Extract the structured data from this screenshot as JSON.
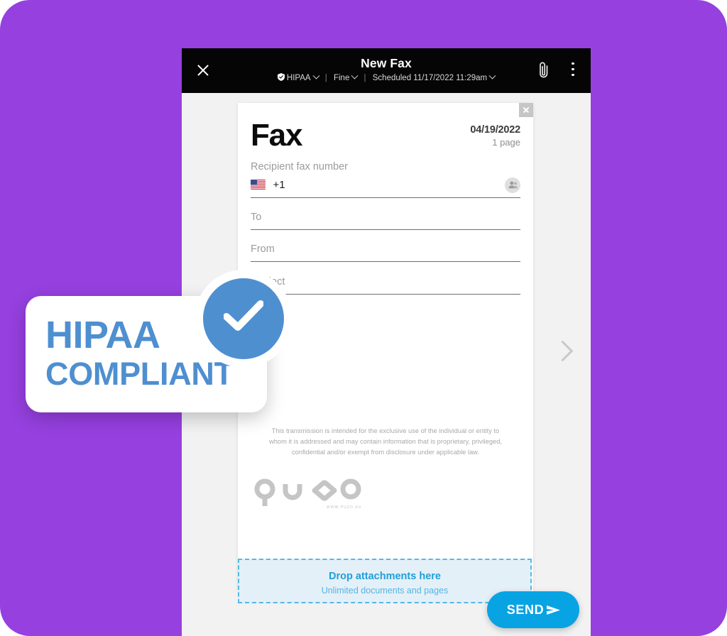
{
  "theme": {
    "page_background": "#9640e0",
    "app_background": "#f2f2f3",
    "topbar_background": "#050505",
    "accent_blue": "#08a3e2",
    "dropzone_blue": "#1f9fda",
    "hipaa_blue": "#4e8fd0",
    "sheet_white": "#ffffff"
  },
  "topbar": {
    "close_label": "close-icon",
    "title": "New Fax",
    "subtitle": {
      "hipaa_label": "HIPAA",
      "quality_label": "Fine",
      "schedule_label": "Scheduled 11/17/2022 11:29am",
      "separator": "|"
    },
    "attach_label": "paperclip-icon",
    "overflow_label": "more-options-icon"
  },
  "fax_sheet": {
    "close_label": "close-icon",
    "title": "Fax",
    "date": "04/19/2022",
    "pages": "1 page",
    "fields": {
      "recipient_label": "Recipient fax number",
      "recipient_country_flag": "us-flag-icon",
      "recipient_value": "+1",
      "contacts_label": "contacts-icon",
      "to_label": "To",
      "to_value": "",
      "from_label": "From",
      "from_value": "",
      "subject_label": "Subject",
      "subject_value": ""
    },
    "disclaimer": "This transmission is intended for the exclusive use of the individual or entity to whom it is addressed and may contain information that is proprietary, privileged, confidential and/or exempt from disclosure under applicable law.",
    "brand": {
      "name": "puzo",
      "url": "WWW.PUZO.EU"
    }
  },
  "dropzone": {
    "title": "Drop attachments here",
    "subtitle": "Unlimited documents and pages"
  },
  "send_button": {
    "label": "SEND",
    "icon": "send-arrow-icon"
  },
  "pager": {
    "next_label": "chevron-right-icon"
  },
  "hipaa_badge": {
    "line1": "HIPAA",
    "line2": "COMPLIANT",
    "check_icon": "check-circle-icon"
  }
}
